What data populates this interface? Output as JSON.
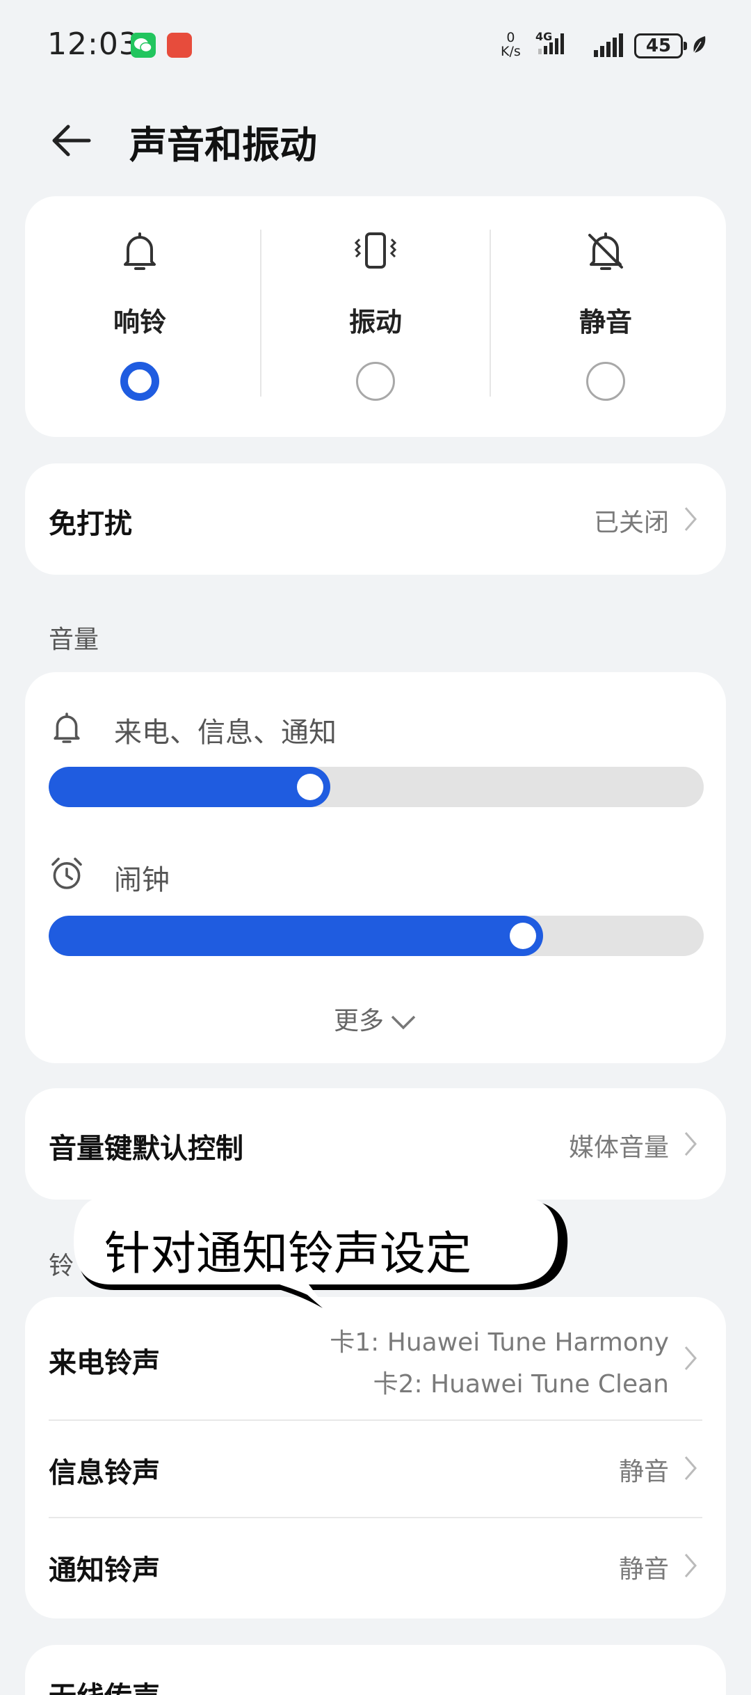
{
  "status_bar": {
    "time": "12:03",
    "net_speed_value": "0",
    "net_speed_unit": "K/s",
    "network_type": "4G",
    "battery": "45"
  },
  "header": {
    "title": "声音和振动"
  },
  "sound_modes": [
    {
      "label": "响铃",
      "icon": "bell-icon",
      "selected": true
    },
    {
      "label": "振动",
      "icon": "vibrate-icon",
      "selected": false
    },
    {
      "label": "静音",
      "icon": "bell-off-icon",
      "selected": false
    }
  ],
  "dnd": {
    "label": "免打扰",
    "value": "已关闭"
  },
  "volume": {
    "section_title": "音量",
    "ring_label": "来电、信息、通知",
    "ring_level": 0.43,
    "alarm_label": "闹钟",
    "alarm_level": 0.755,
    "more_label": "更多"
  },
  "volume_key": {
    "label": "音量键默认控制",
    "value": "媒体音量"
  },
  "ringtones": {
    "section_title_partial": "铃",
    "call": {
      "label": "来电铃声",
      "value_sim1": "卡1: Huawei Tune Harmony",
      "value_sim2": "卡2: Huawei Tune Clean"
    },
    "message": {
      "label": "信息铃声",
      "value": "静音"
    },
    "notification": {
      "label": "通知铃声",
      "value": "静音"
    }
  },
  "bottom_row": {
    "label": "无线传声"
  },
  "overlay_caption": "针对通知铃声设定",
  "colors": {
    "accent": "#1f5ce0",
    "background": "#f1f3f5"
  }
}
